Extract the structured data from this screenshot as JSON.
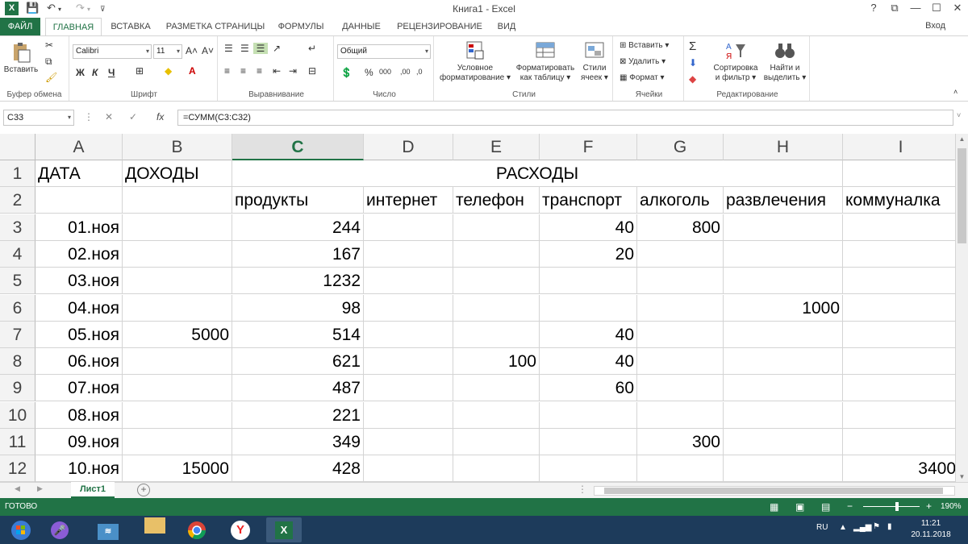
{
  "titlebar": {
    "title": "Книга1 - Excel",
    "help": "?",
    "restore_ribbon": "⧉",
    "minimize": "—",
    "maximize": "☐",
    "close": "✕"
  },
  "tabs": [
    {
      "label": "ФАЙЛ"
    },
    {
      "label": "ГЛАВНАЯ"
    },
    {
      "label": "ВСТАВКА"
    },
    {
      "label": "РАЗМЕТКА СТРАНИЦЫ"
    },
    {
      "label": "ФОРМУЛЫ"
    },
    {
      "label": "ДАННЫЕ"
    },
    {
      "label": "РЕЦЕНЗИРОВАНИЕ"
    },
    {
      "label": "ВИД"
    }
  ],
  "signin": "Вход",
  "ribbon": {
    "clipboard": {
      "paste": "Вставить",
      "label": "Буфер обмена"
    },
    "font": {
      "name": "Calibri",
      "size": "11",
      "bold": "Ж",
      "italic": "К",
      "underline": "Ч",
      "grow": "A˄",
      "shrink": "A˅",
      "label": "Шрифт"
    },
    "alignment": {
      "label": "Выравнивание"
    },
    "number": {
      "format": "Общий",
      "percent": "%",
      "thousands": "000",
      "inc_dec": ",00",
      "dec_dec": ",0",
      "label": "Число"
    },
    "styles": {
      "conditional_1": "Условное",
      "conditional_2": "форматирование",
      "table_1": "Форматировать",
      "table_2": "как таблицу",
      "cell_1": "Стили",
      "cell_2": "ячеек",
      "label": "Стили"
    },
    "cells": {
      "insert": "Вставить",
      "delete": "Удалить",
      "format": "Формат",
      "label": "Ячейки"
    },
    "editing": {
      "sort_1": "Сортировка",
      "sort_2": "и фильтр",
      "find_1": "Найти и",
      "find_2": "выделить",
      "label": "Редактирование"
    }
  },
  "formula_bar": {
    "name_box": "C33",
    "formula": "=СУММ(C3:C32)"
  },
  "sheet": {
    "columns": [
      "A",
      "B",
      "C",
      "D",
      "E",
      "F",
      "G",
      "H",
      "I"
    ],
    "selected_column": "C",
    "rows": [
      {
        "n": "1",
        "cells": [
          "ДАТА",
          "ДОХОДЫ",
          "РАСХОДЫ",
          "",
          "",
          "",
          "",
          "",
          ""
        ]
      },
      {
        "n": "2",
        "cells": [
          "",
          "",
          "продукты",
          "интернет",
          "телефон",
          "транспорт",
          "алкоголь",
          "развлечения",
          "коммуналка"
        ]
      },
      {
        "n": "3",
        "cells": [
          "01.ноя",
          "",
          "244",
          "",
          "",
          "40",
          "800",
          "",
          ""
        ]
      },
      {
        "n": "4",
        "cells": [
          "02.ноя",
          "",
          "167",
          "",
          "",
          "20",
          "",
          "",
          ""
        ]
      },
      {
        "n": "5",
        "cells": [
          "03.ноя",
          "",
          "1232",
          "",
          "",
          "",
          "",
          "",
          ""
        ]
      },
      {
        "n": "6",
        "cells": [
          "04.ноя",
          "",
          "98",
          "",
          "",
          "",
          "",
          "1000",
          ""
        ]
      },
      {
        "n": "7",
        "cells": [
          "05.ноя",
          "5000",
          "514",
          "",
          "",
          "40",
          "",
          "",
          ""
        ]
      },
      {
        "n": "8",
        "cells": [
          "06.ноя",
          "",
          "621",
          "",
          "100",
          "40",
          "",
          "",
          ""
        ]
      },
      {
        "n": "9",
        "cells": [
          "07.ноя",
          "",
          "487",
          "",
          "",
          "60",
          "",
          "",
          ""
        ]
      },
      {
        "n": "10",
        "cells": [
          "08.ноя",
          "",
          "221",
          "",
          "",
          "",
          "",
          "",
          ""
        ]
      },
      {
        "n": "11",
        "cells": [
          "09.ноя",
          "",
          "349",
          "",
          "",
          "",
          "300",
          "",
          ""
        ]
      },
      {
        "n": "12",
        "cells": [
          "10.ноя",
          "15000",
          "428",
          "",
          "",
          "",
          "",
          "",
          "3400"
        ]
      }
    ]
  },
  "sheet_tabs": {
    "active": "Лист1",
    "add": "+"
  },
  "status": {
    "ready": "ГОТОВО",
    "zoom": "190%",
    "minus": "−",
    "plus": "+"
  },
  "taskbar": {
    "lang": "RU",
    "time": "11:21",
    "date": "20.11.2018"
  },
  "colors": {
    "excel_green": "#217346"
  }
}
